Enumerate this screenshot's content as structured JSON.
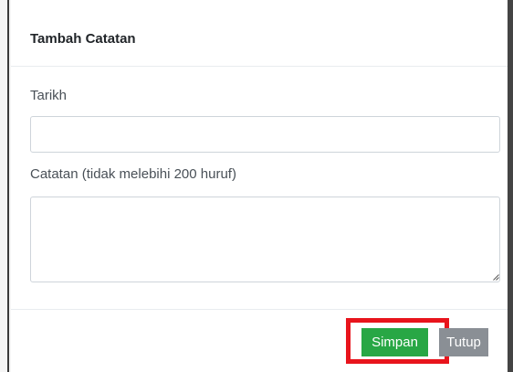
{
  "dialog": {
    "title": "Tambah Catatan"
  },
  "form": {
    "date_label": "Tarikh",
    "date_value": "",
    "note_label": "Catatan (tidak melebihi 200 huruf)",
    "note_value": ""
  },
  "footer": {
    "save_label": "Simpan",
    "close_label": "Tutup"
  },
  "colors": {
    "save_button": "#28a745",
    "close_button": "#8a8f95",
    "highlight": "#e8141c"
  }
}
